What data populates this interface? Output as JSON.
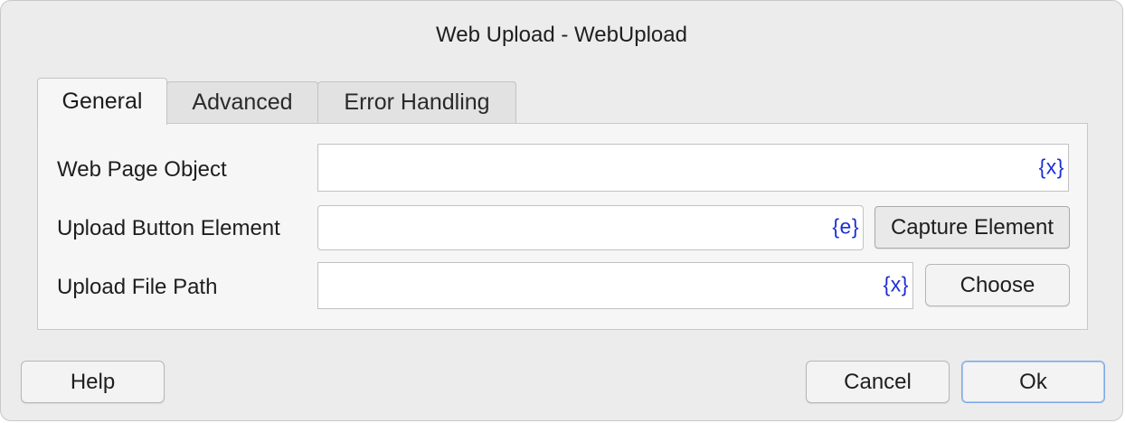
{
  "dialog": {
    "title": "Web Upload - WebUpload"
  },
  "tabs": [
    {
      "label": "General",
      "active": true
    },
    {
      "label": "Advanced",
      "active": false
    },
    {
      "label": "Error Handling",
      "active": false
    }
  ],
  "form": {
    "web_page_object": {
      "label": "Web Page Object",
      "value": "",
      "var_button": "{x}"
    },
    "upload_button_element": {
      "label": "Upload Button Element",
      "value": "",
      "var_button": "{e}",
      "action_label": "Capture Element"
    },
    "upload_file_path": {
      "label": "Upload File Path",
      "value": "",
      "var_button": "{x}",
      "action_label": "Choose"
    }
  },
  "footer": {
    "help_label": "Help",
    "cancel_label": "Cancel",
    "ok_label": "Ok"
  },
  "colors": {
    "variable_accent": "#1f2fd6",
    "default_button_border": "#7fa9e6"
  }
}
